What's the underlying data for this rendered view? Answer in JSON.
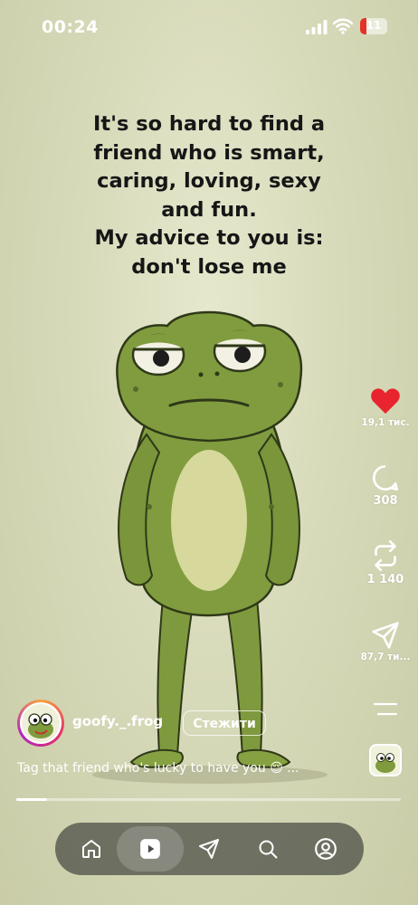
{
  "status_bar": {
    "time": "00:24",
    "battery": "11",
    "battery_color": "#e2332a"
  },
  "post": {
    "meme_text": [
      "It's so hard to find a",
      "friend who is smart,",
      "caring, loving, sexy",
      "and fun.",
      "My advice to you is:",
      "don't lose me"
    ],
    "author": {
      "username": "goofy._.frog",
      "follow_label": "Стежити"
    },
    "caption": "Tag that friend who's lucky to have you 😌 ...",
    "progress": 0.08
  },
  "actions": {
    "likes": "19,1 тис.",
    "comments": "308",
    "reposts": "1 140",
    "shares": "87,7 ти..."
  },
  "colors": {
    "like": "#e8242e",
    "background": "#d7dab9"
  },
  "icons": {
    "like": "heart-icon",
    "comment": "comment-icon",
    "repost": "repost-icon",
    "share": "share-icon",
    "menu": "menu-icon",
    "nav": [
      "home-icon",
      "reels-icon",
      "send-icon",
      "search-icon",
      "profile-icon"
    ]
  }
}
